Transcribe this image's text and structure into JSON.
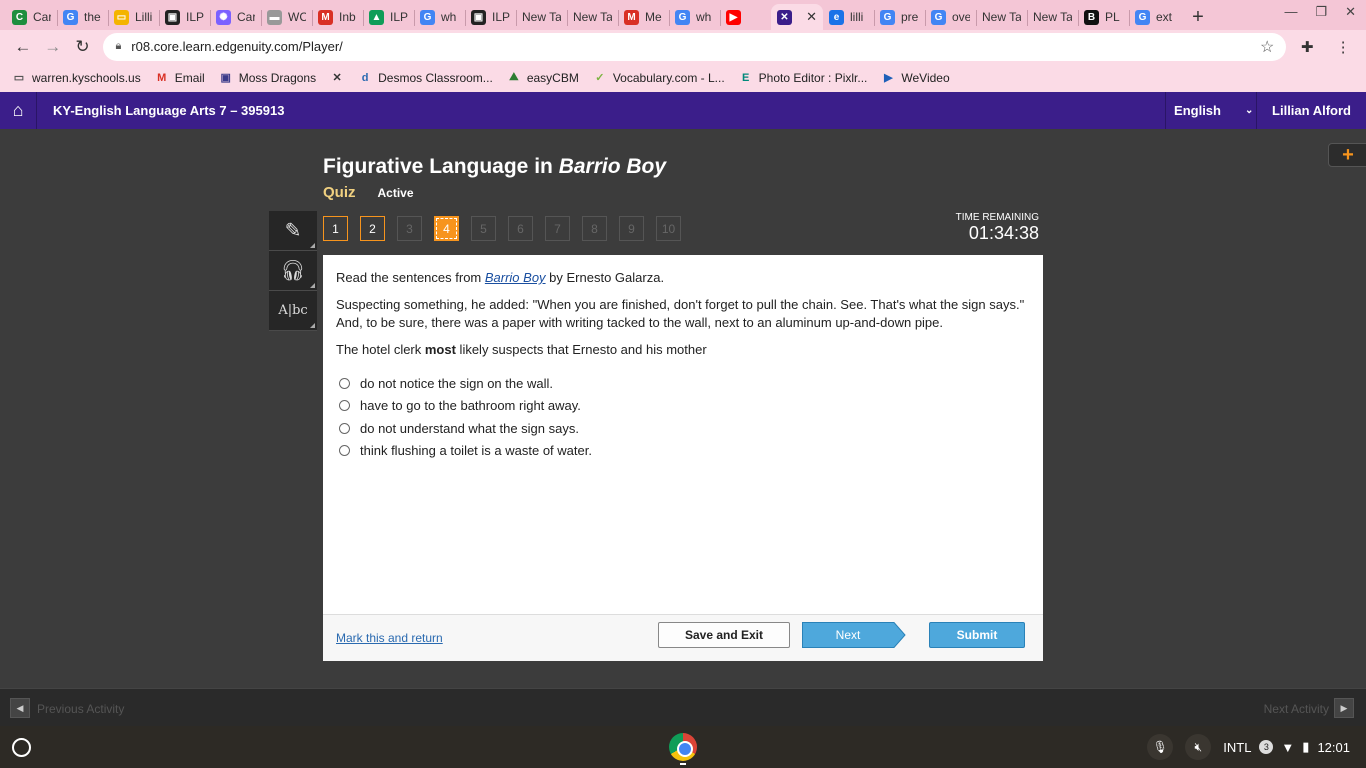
{
  "browser": {
    "tabs": [
      {
        "label": "Car",
        "icon": "classroom-icon",
        "color": "#1e8e3e",
        "glyph": "C"
      },
      {
        "label": "the",
        "icon": "google-icon",
        "color": "#4285f4",
        "glyph": "G"
      },
      {
        "label": "Lilli",
        "icon": "folder-icon",
        "color": "#f4b400",
        "glyph": "▭"
      },
      {
        "label": "ILP",
        "icon": "contact-card-icon",
        "color": "#222222",
        "glyph": "▣"
      },
      {
        "label": "Car",
        "icon": "gear-flower-icon",
        "color": "#7b61ff",
        "glyph": "✺"
      },
      {
        "label": "WC",
        "icon": "doc-icon",
        "color": "#999999",
        "glyph": "▬"
      },
      {
        "label": "Inb",
        "icon": "gmail-icon",
        "color": "#d93025",
        "glyph": "M"
      },
      {
        "label": "ILP",
        "icon": "drive-icon",
        "color": "#0f9d58",
        "glyph": "▲"
      },
      {
        "label": "wh",
        "icon": "google-icon",
        "color": "#4285f4",
        "glyph": "G"
      },
      {
        "label": "ILP",
        "icon": "contact-card-icon",
        "color": "#222222",
        "glyph": "▣"
      },
      {
        "label": "New Ta",
        "icon": "",
        "color": "",
        "glyph": ""
      },
      {
        "label": "New Ta",
        "icon": "",
        "color": "",
        "glyph": ""
      },
      {
        "label": "Me",
        "icon": "gmail-icon",
        "color": "#d93025",
        "glyph": "M"
      },
      {
        "label": "wh",
        "icon": "google-icon",
        "color": "#4285f4",
        "glyph": "G"
      },
      {
        "label": "",
        "icon": "youtube-icon",
        "color": "#ff0000",
        "glyph": "▶"
      },
      {
        "label": "",
        "icon": "edgenuity-icon",
        "color": "#3b1e8a",
        "glyph": "✕",
        "active": true
      },
      {
        "label": "lilli",
        "icon": "edge-icon",
        "color": "#1a73e8",
        "glyph": "e"
      },
      {
        "label": "pre",
        "icon": "google-icon",
        "color": "#4285f4",
        "glyph": "G"
      },
      {
        "label": "ove",
        "icon": "google-icon",
        "color": "#4285f4",
        "glyph": "G"
      },
      {
        "label": "New Ta",
        "icon": "",
        "color": "",
        "glyph": ""
      },
      {
        "label": "New Ta",
        "icon": "",
        "color": "",
        "glyph": ""
      },
      {
        "label": "PL",
        "icon": "bookmark-icon",
        "color": "#111111",
        "glyph": "B"
      },
      {
        "label": "ext",
        "icon": "google-icon",
        "color": "#4285f4",
        "glyph": "G"
      }
    ],
    "url": "r08.core.learn.edgenuity.com/Player/",
    "bookmarks": [
      {
        "label": "warren.kyschools.us",
        "icon": "folder-icon",
        "color": "#555555",
        "glyph": "▭"
      },
      {
        "label": "Email",
        "icon": "gmail-icon",
        "color": "#d93025",
        "glyph": "M"
      },
      {
        "label": "Moss Dragons",
        "icon": "contact-card-icon",
        "color": "#3b3b8a",
        "glyph": "▣"
      },
      {
        "label": "",
        "icon": "edgenuity-icon",
        "color": "#333333",
        "glyph": "✕"
      },
      {
        "label": "Desmos Classroom...",
        "icon": "desmos-icon",
        "color": "#2a6ab0",
        "glyph": "d"
      },
      {
        "label": "easyCBM",
        "icon": "mountain-icon",
        "color": "#2e7d32",
        "glyph": "⛰"
      },
      {
        "label": "Vocabulary.com - L...",
        "icon": "check-icon",
        "color": "#7cb342",
        "glyph": "✓"
      },
      {
        "label": "Photo Editor : Pixlr...",
        "icon": "pixlr-icon",
        "color": "#00897b",
        "glyph": "E"
      },
      {
        "label": "WeVideo",
        "icon": "wevideo-icon",
        "color": "#1e5fb8",
        "glyph": "▶"
      }
    ]
  },
  "app": {
    "course": "KY-English Language Arts 7 – 395913",
    "language": "English",
    "user": "Lillian Alford"
  },
  "lesson": {
    "title_prefix": "Figurative Language in ",
    "title_italic": "Barrio Boy",
    "type": "Quiz",
    "status": "Active",
    "questions": [
      {
        "n": "1",
        "state": "done"
      },
      {
        "n": "2",
        "state": "done"
      },
      {
        "n": "3",
        "state": "todo"
      },
      {
        "n": "4",
        "state": "current"
      },
      {
        "n": "5",
        "state": "todo"
      },
      {
        "n": "6",
        "state": "todo"
      },
      {
        "n": "7",
        "state": "todo"
      },
      {
        "n": "8",
        "state": "todo"
      },
      {
        "n": "9",
        "state": "todo"
      },
      {
        "n": "10",
        "state": "todo"
      }
    ],
    "timer_label": "TIME REMAINING",
    "timer_value": "01:34:38"
  },
  "question": {
    "intro_a": "Read the sentences from ",
    "intro_link": "Barrio Boy",
    "intro_b": " by Ernesto Galarza.",
    "passage": "Suspecting something, he added: \"When you are finished, don't forget to pull the chain. See. That's what the sign says.\" And, to be sure, there was a paper with writing tacked to the wall, next to an aluminum up-and-down pipe.",
    "stem_a": "The hotel clerk ",
    "stem_bold": "most",
    "stem_b": " likely suspects that Ernesto and his mother",
    "choices": [
      "do not notice the sign on the wall.",
      "have to go to the bathroom right away.",
      "do not understand what the sign says.",
      "think flushing a toilet is a waste of water."
    ]
  },
  "footer": {
    "mark": "Mark this and return",
    "save": "Save and Exit",
    "next": "Next",
    "submit": "Submit"
  },
  "activity_nav": {
    "prev": "Previous Activity",
    "next": "Next Activity"
  },
  "shelf": {
    "ime": "INTL",
    "notifications": "3",
    "time": "12:01"
  },
  "colors": {
    "header": "#3b1e8a",
    "accent": "#f7941d",
    "browser_frame": "#f4c6d6",
    "submit": "#4ea8dc"
  }
}
